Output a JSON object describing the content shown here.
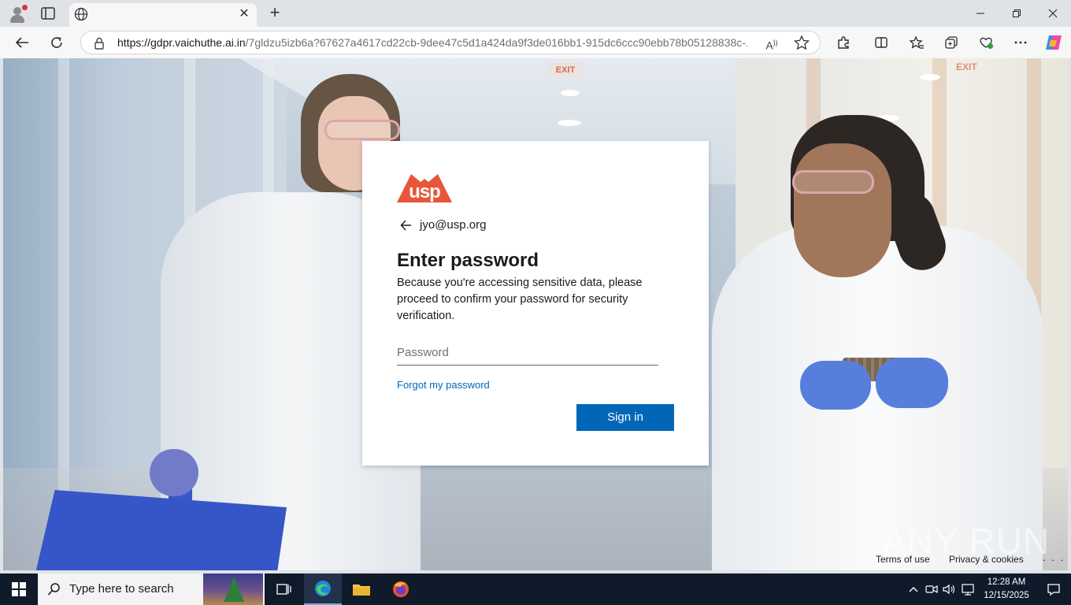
{
  "browser": {
    "tab_title": "",
    "address": {
      "url_host": "https://gdpr.vaichuthe.ai.in",
      "url_path": "/7gldzu5izb6a?67627a4617cd22cb-9dee47c5d1a424da9f3de016bb1-915dc6ccc90ebb78b05128838c-..."
    }
  },
  "page": {
    "background_exit_sign_left": "EXIT",
    "background_exit_sign_right": "EXIT",
    "login": {
      "logo_text": "usp",
      "logo_color": "#e8563a",
      "identity_email": "jyo@usp.org",
      "title": "Enter password",
      "description": "Because you're accessing sensitive data, please proceed to confirm your password for security verification.",
      "password_placeholder": "Password",
      "password_value": "",
      "forgot_link": "Forgot my password",
      "signin_label": "Sign in",
      "accent_color": "#0067b8"
    },
    "footer": {
      "terms": "Terms of use",
      "privacy": "Privacy & cookies",
      "more": ". . ."
    },
    "watermark": "ANY RUN"
  },
  "taskbar": {
    "search_placeholder": "Type here to search",
    "clock_time": "12:28 AM",
    "clock_date": "12/15/2025",
    "pinned": [
      "task-view-icon",
      "edge-icon",
      "file-explorer-icon",
      "firefox-icon"
    ],
    "tray": [
      "chevron-up-icon",
      "meet-now-icon",
      "speaker-icon",
      "network-icon",
      "notification-icon"
    ]
  },
  "icons": {
    "toolbar": [
      "back-icon",
      "refresh-icon",
      "lock-icon",
      "read-aloud-icon",
      "favorite-star-icon",
      "extensions-icon",
      "split-screen-icon",
      "favorites-icon",
      "collections-icon",
      "browser-essentials-icon",
      "more-icon",
      "copilot-icon"
    ]
  }
}
